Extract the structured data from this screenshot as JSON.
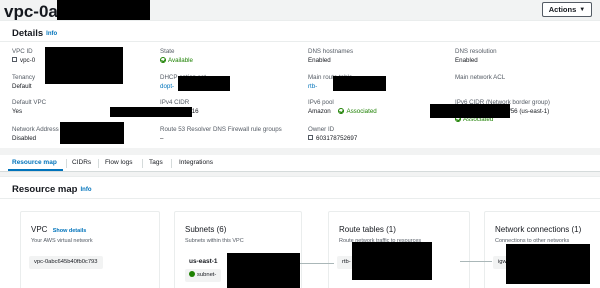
{
  "header": {
    "title": "vpc-0a",
    "actions_label": "Actions"
  },
  "details": {
    "title": "Details",
    "info": "Info",
    "fields": {
      "vpc_id": {
        "label": "VPC ID",
        "value": "vpc-0"
      },
      "state": {
        "label": "State",
        "value": "Available"
      },
      "dns_hostnames": {
        "label": "DNS hostnames",
        "value": "Enabled"
      },
      "dns_resolution": {
        "label": "DNS resolution",
        "value": "Enabled"
      },
      "tenancy": {
        "label": "Tenancy",
        "value": "Default"
      },
      "dhcp_option_set": {
        "label": "DHCP option set",
        "value": "dopt-"
      },
      "main_route_table": {
        "label": "Main route table",
        "value": "rtb-"
      },
      "main_network_acl": {
        "label": "Main network ACL",
        "value": ""
      },
      "default_vpc": {
        "label": "Default VPC",
        "value": "Yes"
      },
      "ipv4_cidr": {
        "label": "IPv4 CIDR",
        "value": "/16"
      },
      "ipv6_pool": {
        "label": "IPv6 pool",
        "value": "Amazon"
      },
      "ipv6_pool_status": "Associated",
      "ipv6_cidr": {
        "label": "IPv6 CIDR (Network border group)",
        "value": "/56 (us-east-1)"
      },
      "ipv6_cidr_status": "Associated",
      "nau_metrics": {
        "label": "Network Address Usage metrics",
        "value": "Disabled"
      },
      "route53": {
        "label": "Route 53 Resolver DNS Firewall rule groups",
        "value": "–"
      },
      "owner_id": {
        "label": "Owner ID",
        "value": "603178752697"
      }
    }
  },
  "tabs": [
    "Resource map",
    "CIDRs",
    "Flow logs",
    "Tags",
    "Integrations"
  ],
  "resource_map": {
    "title": "Resource map",
    "info": "Info",
    "vpc_card": {
      "title": "VPC",
      "link": "Show details",
      "subtitle": "Your AWS virtual network",
      "item": "vpc-0abc645b40fb0c793"
    },
    "subnets_card": {
      "title": "Subnets (6)",
      "subtitle": "Subnets within this VPC",
      "group": "us-east-1",
      "item": "subnet-"
    },
    "route_tables_card": {
      "title": "Route tables (1)",
      "subtitle": "Route network traffic to resources",
      "item": "rtb-"
    },
    "network_card": {
      "title": "Network connections (1)",
      "subtitle": "Connections to other networks",
      "item": "igw-"
    }
  },
  "icons": [
    "caret-down-icon",
    "copy-icon",
    "check-circle-icon",
    "external-link-icon",
    "subnet-icon"
  ],
  "colors": {
    "link": "#0073bb",
    "success": "#1d8102",
    "redaction": "#000000"
  }
}
